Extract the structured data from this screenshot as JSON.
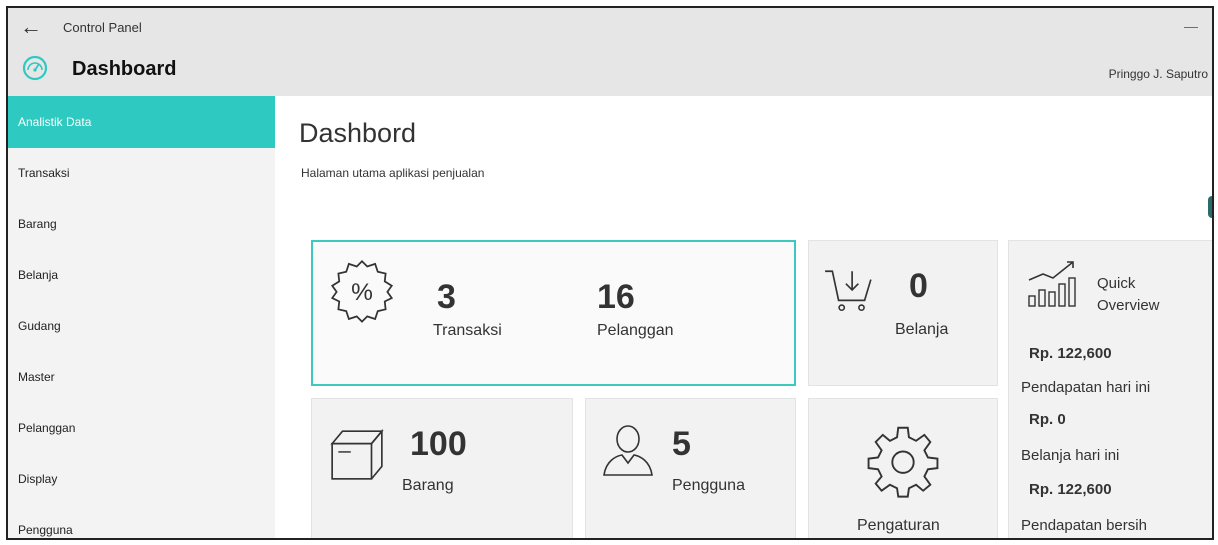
{
  "window": {
    "title": "Control Panel",
    "back_icon": "back-arrow-icon",
    "minimize_label": "—"
  },
  "header": {
    "title": "Dashboard",
    "user": "Pringgo J. Saputro"
  },
  "sidebar": {
    "items": [
      {
        "label": "Analistik Data",
        "active": true
      },
      {
        "label": "Transaksi"
      },
      {
        "label": "Barang"
      },
      {
        "label": "Belanja"
      },
      {
        "label": "Gudang"
      },
      {
        "label": "Master"
      },
      {
        "label": "Pelanggan"
      },
      {
        "label": "Display"
      },
      {
        "label": "Pengguna"
      }
    ]
  },
  "main": {
    "title": "Dashbord",
    "subtitle": "Halaman utama aplikasi penjualan",
    "cards": {
      "transaksi": {
        "value": "3",
        "label": "Transaksi"
      },
      "pelanggan": {
        "value": "16",
        "label": "Pelanggan"
      },
      "belanja": {
        "value": "0",
        "label": "Belanja"
      },
      "barang": {
        "value": "100",
        "label": "Barang"
      },
      "pengguna": {
        "value": "5",
        "label": "Pengguna"
      },
      "pengaturan": {
        "label": "Pengaturan"
      }
    },
    "quick_overview": {
      "title_line1": "Quick",
      "title_line2": "Overview",
      "pendapatan_value": "Rp.  122,600",
      "pendapatan_label": "Pendapatan hari ini",
      "belanja_value": "Rp. 0",
      "belanja_label": "Belanja hari ini",
      "bersih_value": "Rp.  122,600",
      "bersih_label": "Pendapatan bersih"
    }
  },
  "colors": {
    "accent": "#2ec9c0",
    "header_bg": "#e6e6e6",
    "sidebar_bg": "#f3f3f3",
    "card_bg": "#f2f2f2"
  }
}
